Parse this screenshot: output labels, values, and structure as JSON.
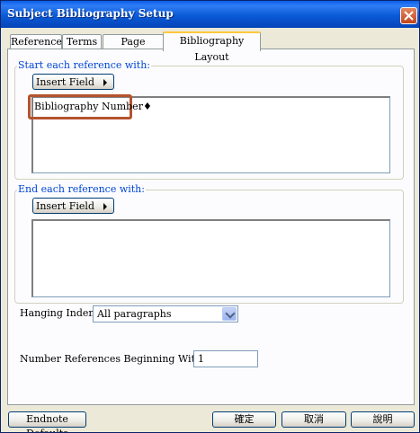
{
  "window": {
    "title": "Subject Bibliography Setup"
  },
  "tabs": [
    {
      "label": "References"
    },
    {
      "label": "Terms"
    },
    {
      "label": "Page Layout"
    },
    {
      "label": "Bibliography Layout",
      "active": true
    }
  ],
  "start_group": {
    "legend": "Start each reference with:",
    "insert_field_label": "Insert Field",
    "content": "Bibliography Number♦"
  },
  "end_group": {
    "legend": "End each reference with:",
    "insert_field_label": "Insert Field",
    "content": ""
  },
  "hanging_indent": {
    "label": "Hanging Indent:",
    "value": "All paragraphs"
  },
  "number_start": {
    "label": "Number References Beginning With:",
    "value": "1"
  },
  "buttons": {
    "endnote_defaults": "Endnote Defaults",
    "ok": "確定",
    "cancel": "取消",
    "help": "說明"
  },
  "colors": {
    "title_bar": "#0a5ee8",
    "legend": "#0046d5",
    "highlight": "#b5532e"
  }
}
